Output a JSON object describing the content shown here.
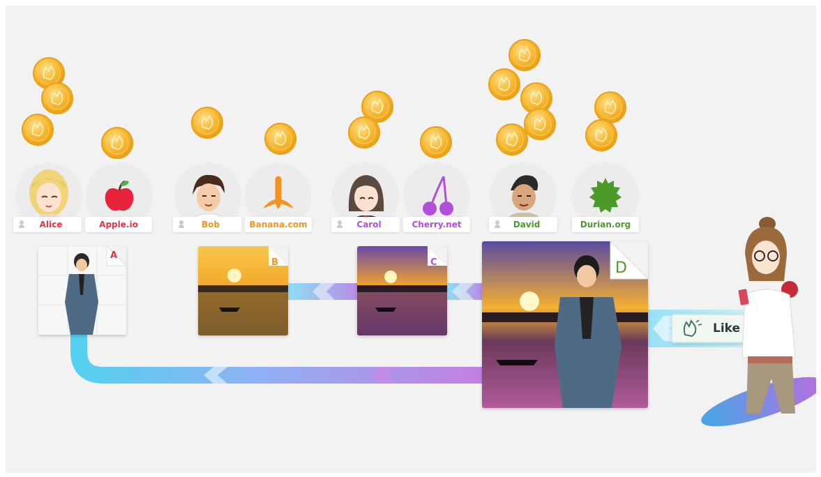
{
  "colors": {
    "background": "#f2f2f2",
    "alice": "#e8334a",
    "bob": "#f2941f",
    "carol": "#b04fd9",
    "david": "#4c9a2a",
    "coin": "#f7b52a",
    "flow_cyan": "#55d0f0",
    "flow_purple": "#b06ee0"
  },
  "participants": [
    {
      "name": "Alice",
      "site": "Apple.io",
      "doc_letter": "A",
      "color": "#e8334a",
      "site_icon": "apple-icon"
    },
    {
      "name": "Bob",
      "site": "Banana.com",
      "doc_letter": "B",
      "color": "#f2941f",
      "site_icon": "banana-icon"
    },
    {
      "name": "Carol",
      "site": "Cherry.net",
      "doc_letter": "C",
      "color": "#b04fd9",
      "site_icon": "cherry-icon"
    },
    {
      "name": "David",
      "site": "Durian.org",
      "doc_letter": "D",
      "color": "#4c9a2a",
      "site_icon": "durian-icon"
    }
  ],
  "like_button": {
    "label": "Like",
    "icon": "clap-hands-icon"
  },
  "coin_icon": "clap-hands-icon"
}
